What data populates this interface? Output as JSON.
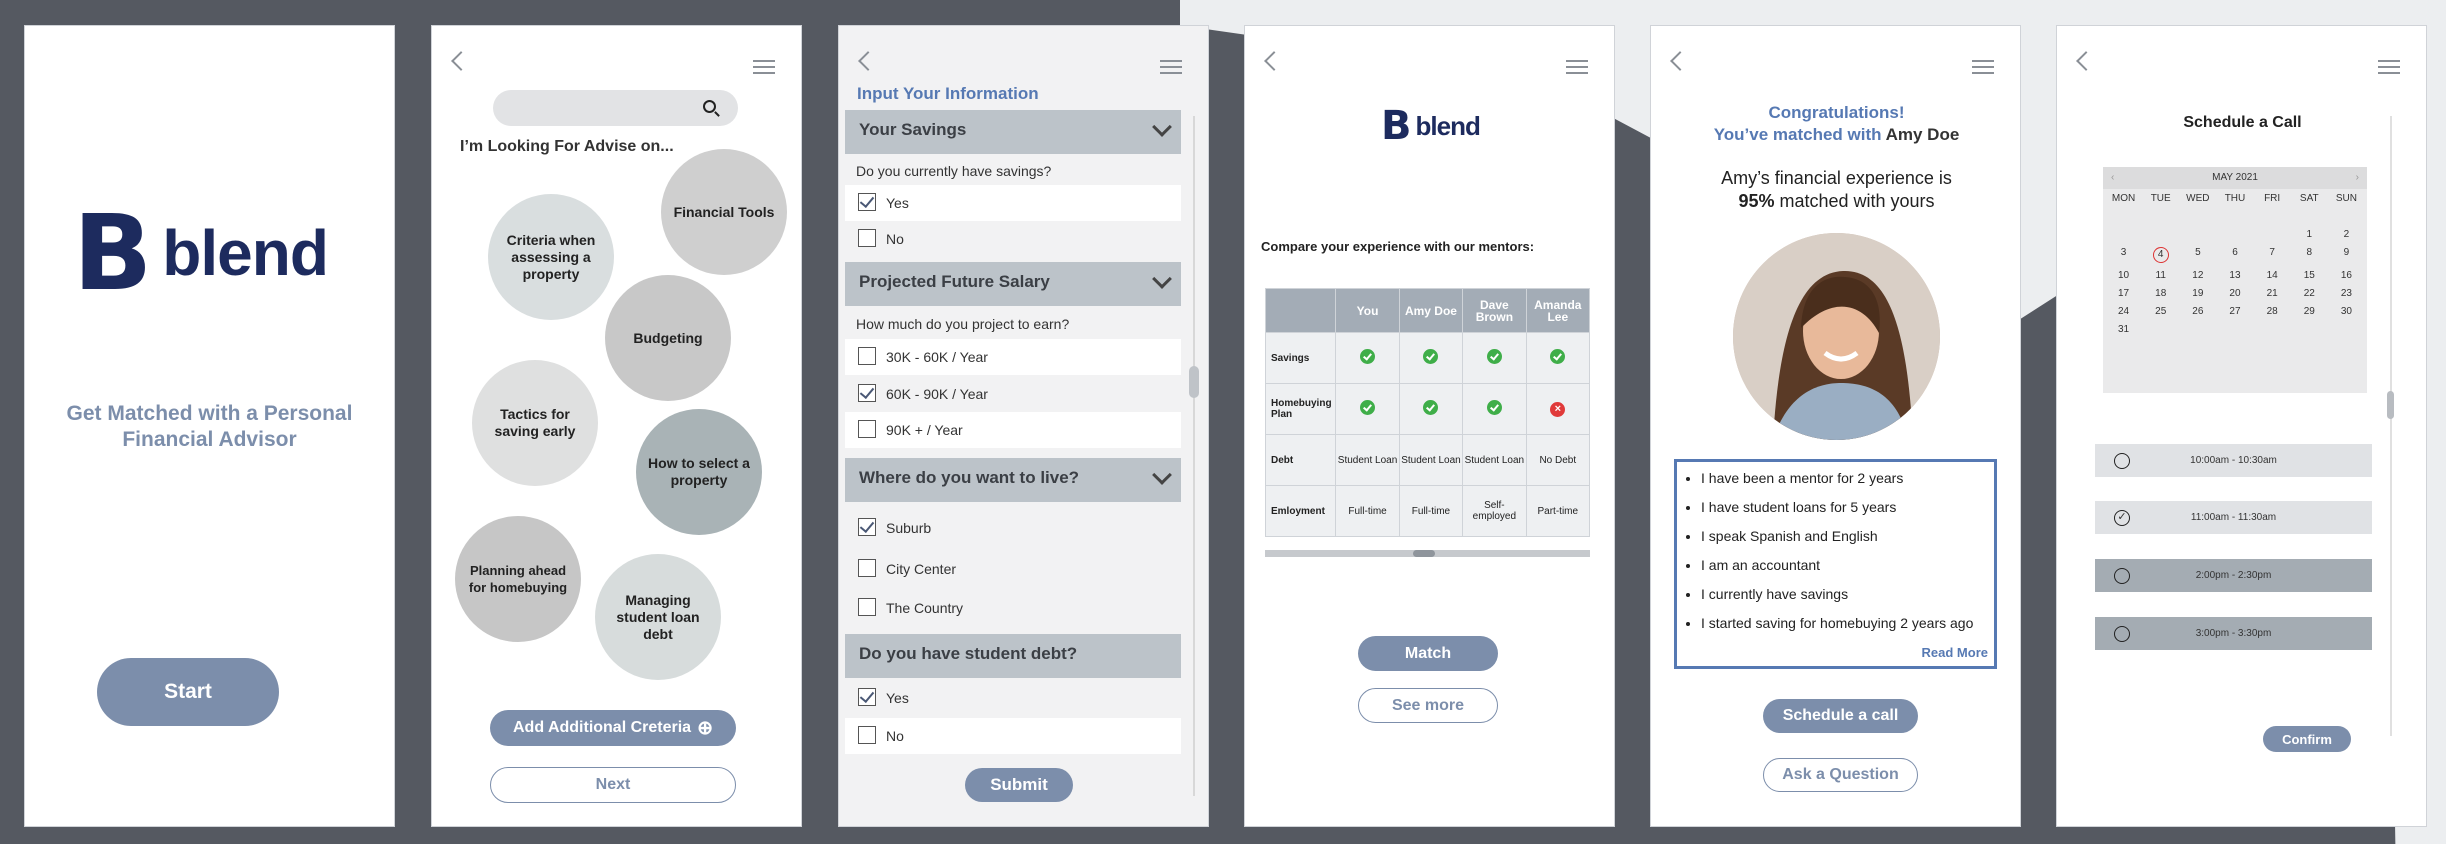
{
  "screen1": {
    "logo_mark": "B",
    "logo_text": "blend",
    "tagline": "Get Matched with a Personal Financial Advisor",
    "start_label": "Start"
  },
  "screen2": {
    "heading": "I’m Looking For Advise on...",
    "bubbles": [
      "Financial Tools",
      "Criteria when assessing a property",
      "Budgeting",
      "Tactics for saving early",
      "How to select a property",
      "Planning ahead for homebuying",
      "Managing student loan debt"
    ],
    "add_criteria_label": "Add Additional Creteria",
    "add_icon": "⊕",
    "next_label": "Next"
  },
  "screen3": {
    "title": "Input Your Information",
    "sections": [
      {
        "label": "Your Savings",
        "question": "Do you currently have savings?",
        "options": [
          {
            "label": "Yes",
            "checked": true
          },
          {
            "label": "No",
            "checked": false
          }
        ]
      },
      {
        "label": "Projected Future Salary",
        "question": "How much do you project to earn?",
        "options": [
          {
            "label": "30K - 60K / Year",
            "checked": false
          },
          {
            "label": "60K - 90K / Year",
            "checked": true
          },
          {
            "label": "90K + / Year",
            "checked": false
          }
        ]
      },
      {
        "label": "Where do you want to live?",
        "question": "",
        "options": [
          {
            "label": "Suburb",
            "checked": true
          },
          {
            "label": "City Center",
            "checked": false
          },
          {
            "label": "The Country",
            "checked": false
          }
        ]
      },
      {
        "label": "Do you have student debt?",
        "question": "",
        "options": [
          {
            "label": "Yes",
            "checked": true
          },
          {
            "label": "No",
            "checked": false
          }
        ]
      }
    ],
    "submit_label": "Submit"
  },
  "screen4": {
    "logo_mark": "B",
    "logo_text": "blend",
    "compare_label": "Compare your experience with our mentors:",
    "columns": [
      "You",
      "Amy Doe",
      "Dave Brown",
      "Amanda Lee"
    ],
    "rows": [
      {
        "label": "Savings",
        "cells": [
          "ok",
          "ok",
          "ok",
          "ok"
        ]
      },
      {
        "label": "Homebuying Plan",
        "cells": [
          "ok",
          "ok",
          "ok",
          "no"
        ]
      },
      {
        "label": "Debt",
        "cells": [
          "Student Loan",
          "Student Loan",
          "Student Loan",
          "No Debt"
        ]
      },
      {
        "label": "Emloyment",
        "cells": [
          "Full-time",
          "Full-time",
          "Self-employed",
          "Part-time"
        ]
      }
    ],
    "match_label": "Match",
    "see_more_label": "See more"
  },
  "screen5": {
    "congrats": "Congratulations!",
    "matched_prefix": "You’ve matched with ",
    "matched_name": "Amy Doe",
    "exp_line1": "Amy’s financial experience is",
    "exp_percent": "95%",
    "exp_line2": " matched with yours",
    "facts": [
      "I have been a mentor for 2 years",
      "I have student loans for 5 years",
      "I speak Spanish and English",
      "I am an accountant",
      "I currently have savings",
      "I started saving for homebuying 2 years ago"
    ],
    "read_more": "Read More",
    "schedule_label": "Schedule a call",
    "ask_label": "Ask a Question"
  },
  "screen6": {
    "title": "Schedule a Call",
    "month": "MAY 2021",
    "day_names": [
      "MON",
      "TUE",
      "WED",
      "THU",
      "FRI",
      "SAT",
      "SUN"
    ],
    "days": [
      "",
      "",
      "",
      "",
      "",
      "1",
      "2",
      "3",
      "4",
      "5",
      "6",
      "7",
      "8",
      "9",
      "10",
      "11",
      "12",
      "13",
      "14",
      "15",
      "16",
      "17",
      "18",
      "19",
      "20",
      "21",
      "22",
      "23",
      "24",
      "25",
      "26",
      "27",
      "28",
      "29",
      "30",
      "31"
    ],
    "selected_day": "4",
    "slots": [
      {
        "label": "10:00am - 10:30am",
        "checked": false,
        "dark": false
      },
      {
        "label": "11:00am - 11:30am",
        "checked": true,
        "dark": false
      },
      {
        "label": "2:00pm - 2:30pm",
        "checked": false,
        "dark": true
      },
      {
        "label": "3:00pm - 3:30pm",
        "checked": false,
        "dark": true
      }
    ],
    "confirm_label": "Confirm"
  },
  "colors": {
    "accent": "#7c8eab",
    "brand": "#1d2b5e",
    "link": "#5679b3"
  }
}
